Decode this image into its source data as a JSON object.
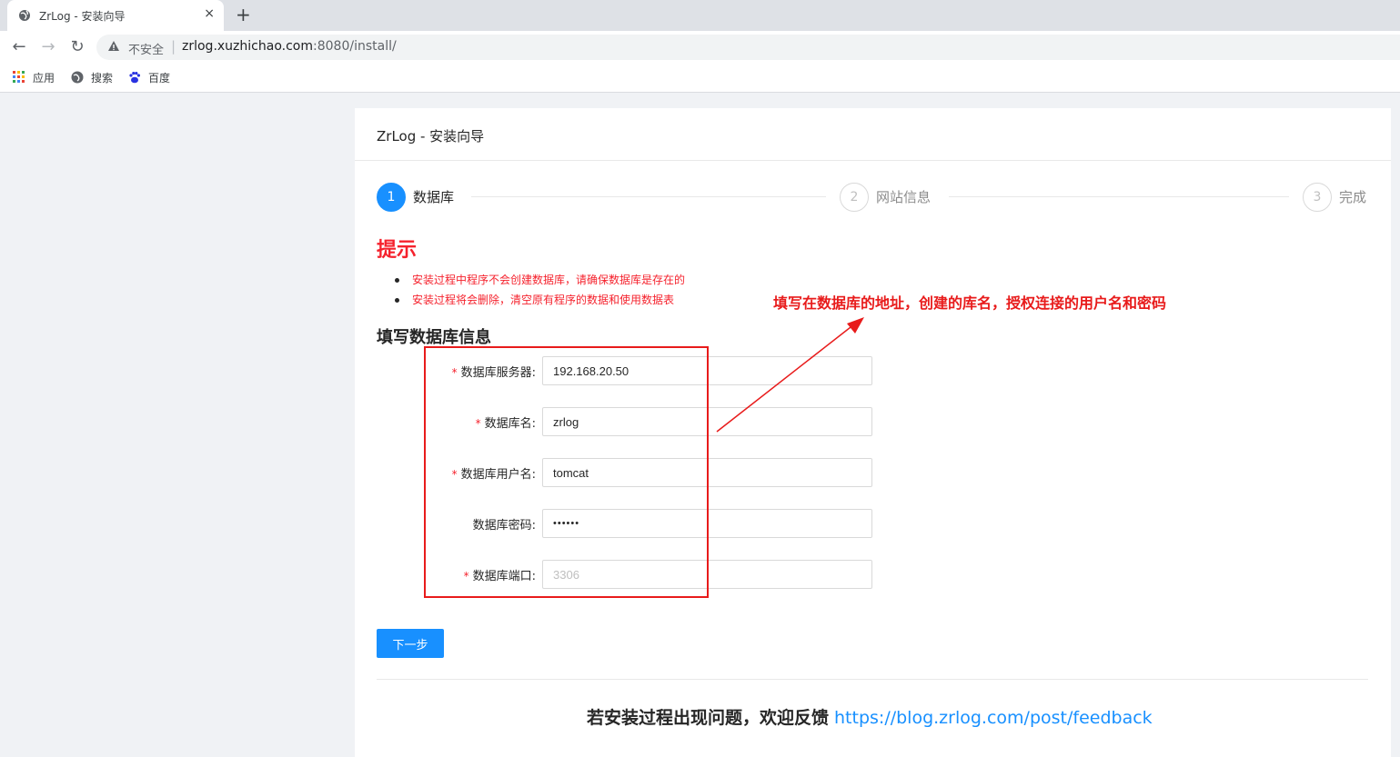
{
  "browser": {
    "tab_title": "ZrLog - 安装向导",
    "tab_close": "×",
    "new_tab": "+",
    "insecure_label": "不安全",
    "url_host": "zrlog.xuzhichao.com",
    "url_rest": ":8080/install/",
    "bookmarks": [
      {
        "label": "应用",
        "icon": "apps-grid-icon"
      },
      {
        "label": "搜索",
        "icon": "globe-icon"
      },
      {
        "label": "百度",
        "icon": "baidu-paw-icon"
      }
    ]
  },
  "page": {
    "title": "ZrLog - 安装向导",
    "steps": [
      {
        "number": "1",
        "label": "数据库",
        "status": "active"
      },
      {
        "number": "2",
        "label": "网站信息",
        "status": "wait"
      },
      {
        "number": "3",
        "label": "完成",
        "status": "wait"
      }
    ],
    "tip_title": "提示",
    "tips": [
      "安装过程中程序不会创建数据库，请确保数据库是存在的",
      "安装过程将会删除，清空原有程序的数据和使用数据表"
    ],
    "section_title": "填写数据库信息",
    "form": {
      "host_label": "数据库服务器:",
      "host_value": "192.168.20.50",
      "dbname_label": "数据库名:",
      "dbname_value": "zrlog",
      "user_label": "数据库用户名:",
      "user_value": "tomcat",
      "password_label": "数据库密码:",
      "password_value": "••••••",
      "port_label": "数据库端口:",
      "port_placeholder": "3306",
      "required_mark": "*"
    },
    "annotation": "填写在数据库的地址，创建的库名，授权连接的用户名和密码",
    "next_button": "下一步",
    "feedback_text": "若安装过程出现问题，欢迎反馈",
    "feedback_link": "https://blog.zrlog.com/post/feedback"
  },
  "colors": {
    "primary": "#1890ff",
    "danger": "#f5222d",
    "annotation_red": "#e81b1b"
  }
}
